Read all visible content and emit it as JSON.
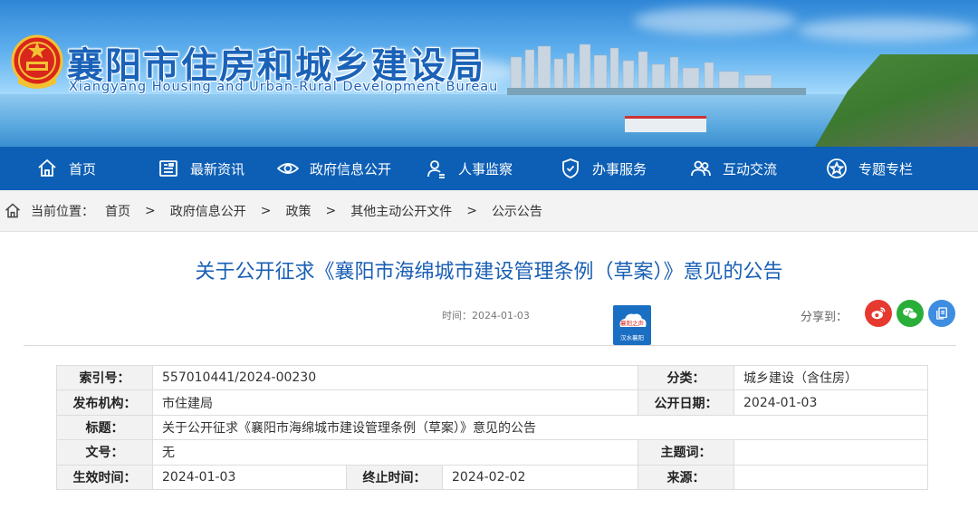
{
  "header": {
    "title": "襄阳市住房和城乡建设局",
    "subtitle": "Xiangyang Housing and Urban-Rural Development Bureau",
    "emblem_icon": "national-emblem-icon"
  },
  "nav": {
    "items": [
      {
        "label": "首页",
        "icon": "home-icon"
      },
      {
        "label": "最新资讯",
        "icon": "newspaper-icon"
      },
      {
        "label": "政府信息公开",
        "icon": "eye-icon"
      },
      {
        "label": "人事监察",
        "icon": "person-icon"
      },
      {
        "label": "办事服务",
        "icon": "shield-icon"
      },
      {
        "label": "互动交流",
        "icon": "users-icon"
      },
      {
        "label": "专题专栏",
        "icon": "star-icon"
      }
    ]
  },
  "breadcrumb": {
    "label": "当前位置：",
    "items": [
      "首页",
      "政府信息公开",
      "政策",
      "其他主动公开文件",
      "公示公告"
    ],
    "separator": ">"
  },
  "article": {
    "title": "关于公开征求《襄阳市海绵城市建设管理条例（草案）》意见的公告",
    "time": "时间：2024-01-03",
    "share_label": "分享到："
  },
  "media_badge": {
    "line1": "襄阳之声",
    "line2": "汉水襄阳"
  },
  "info_table": {
    "index_label": "索引号：",
    "index_value": "557010441/2024-00230",
    "category_label": "分类：",
    "category_value": "城乡建设（含住房）",
    "publisher_label": "发布机构：",
    "publisher_value": "市住建局",
    "open_date_label": "公开日期：",
    "open_date_value": "2024-01-03",
    "title_label": "标题：",
    "title_value": "关于公开征求《襄阳市海绵城市建设管理条例（草案）》意见的公告",
    "doc_no_label": "文号：",
    "doc_no_value": "无",
    "keywords_label": "主题词：",
    "keywords_value": "",
    "effective_label": "生效时间：",
    "effective_value": "2024-01-03",
    "end_label": "终止时间：",
    "end_value": "2024-02-02",
    "source_label": "来源：",
    "source_value": ""
  },
  "colors": {
    "nav_bg": "#0d5fb5",
    "title_blue": "#1a5fb4",
    "weibo": "#e6392f",
    "wechat": "#2aae3a",
    "copy": "#3e8de0"
  }
}
